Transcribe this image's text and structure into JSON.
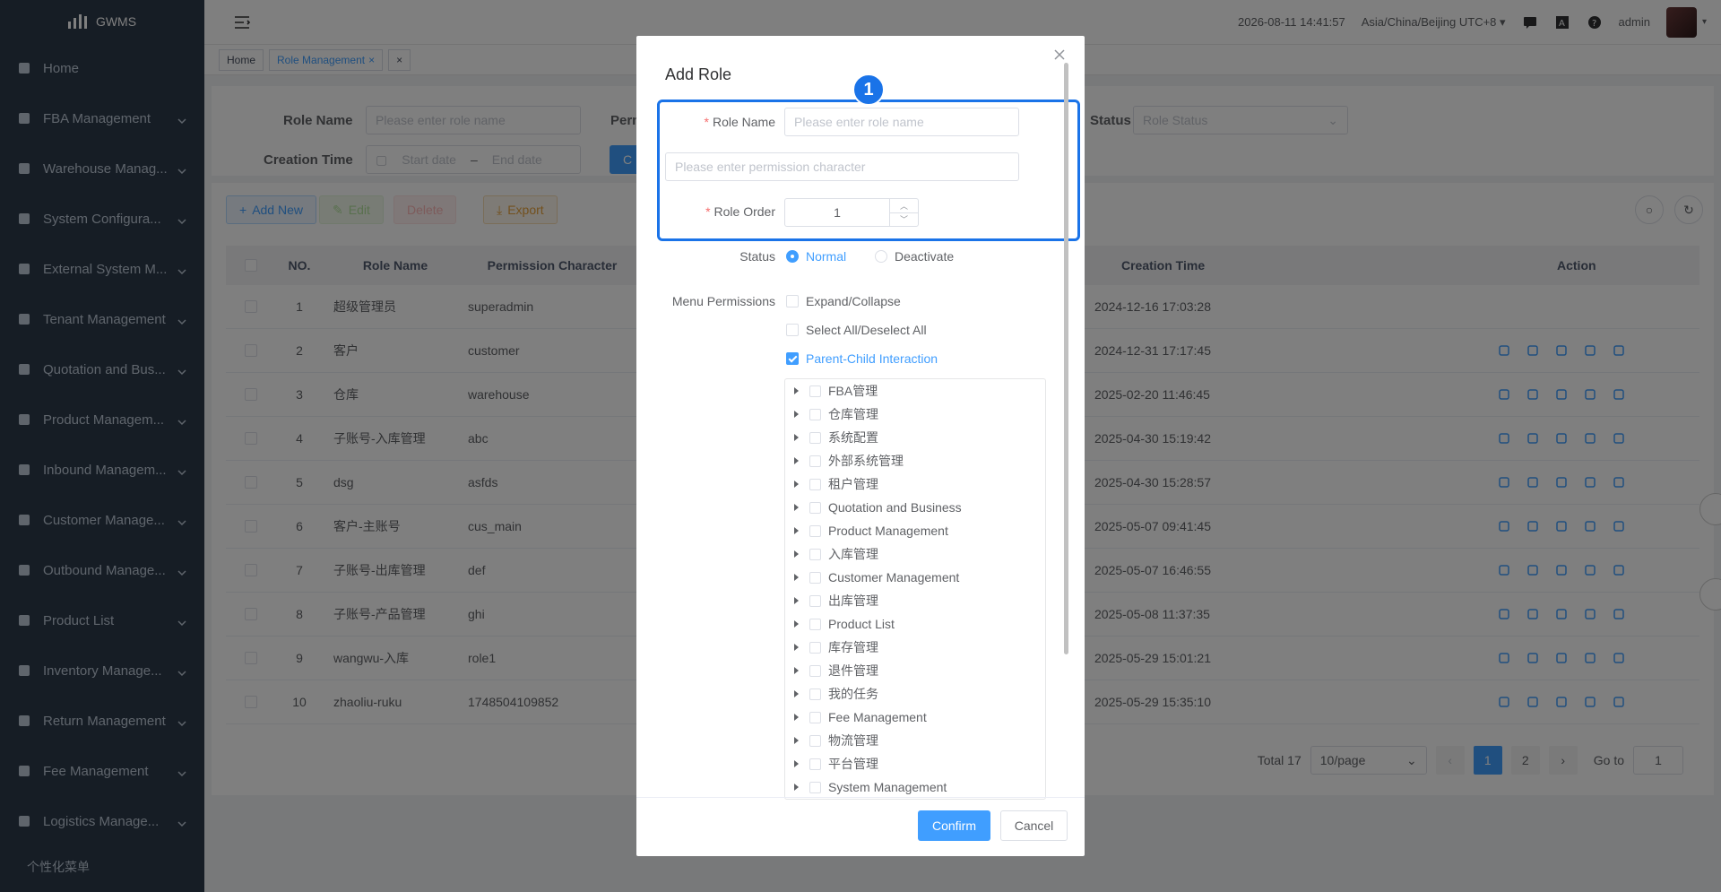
{
  "app": {
    "name": "GWMS"
  },
  "sidebar": {
    "items": [
      {
        "label": "Home",
        "icon": "dashboard-icon",
        "has_children": false
      },
      {
        "label": "FBA Management",
        "icon": "clipboard-icon",
        "has_children": true
      },
      {
        "label": "Warehouse Manag...",
        "icon": "pie-icon",
        "has_children": true
      },
      {
        "label": "System Configura...",
        "icon": "monitor-icon",
        "has_children": true
      },
      {
        "label": "External System M...",
        "icon": "grid-icon",
        "has_children": true
      },
      {
        "label": "Tenant Management",
        "icon": "chart-icon",
        "has_children": true
      },
      {
        "label": "Quotation and Bus...",
        "icon": "doc-icon",
        "has_children": true
      },
      {
        "label": "Product Managem...",
        "icon": "cart-icon",
        "has_children": true
      },
      {
        "label": "Inbound Managem...",
        "icon": "home-icon",
        "has_children": true
      },
      {
        "label": "Customer Manage...",
        "icon": "user-icon",
        "has_children": true
      },
      {
        "label": "Outbound Manage...",
        "icon": "grid-icon",
        "has_children": true
      },
      {
        "label": "Product List",
        "icon": "book-icon",
        "has_children": true
      },
      {
        "label": "Inventory Manage...",
        "icon": "table-icon",
        "has_children": true
      },
      {
        "label": "Return Management",
        "icon": "return-icon",
        "has_children": true
      },
      {
        "label": "Fee Management",
        "icon": "yen-icon",
        "has_children": true
      },
      {
        "label": "Logistics Manage...",
        "icon": "grid-icon",
        "has_children": true
      }
    ],
    "bottom_label": "个性化菜单"
  },
  "topbar": {
    "datetime": "2026-08-11 14:41:57",
    "timezone": "Asia/China/Beijing UTC+8",
    "user": "admin"
  },
  "tags": [
    {
      "label": "Home",
      "active": false
    },
    {
      "label": "Role Management",
      "active": true
    }
  ],
  "search": {
    "role_name_label": "Role Name",
    "role_name_placeholder": "Please enter role name",
    "perm_label_partial": "Perm",
    "status_label": "Status",
    "status_placeholder": "Role Status",
    "creation_time_label": "Creation Time",
    "start_placeholder": "Start date",
    "date_separator": "–",
    "end_placeholder": "End date",
    "search_btn_partial": "C"
  },
  "toolbar": {
    "add_label": "Add New",
    "edit_label": "Edit",
    "delete_label": "Delete",
    "export_label": "Export"
  },
  "table": {
    "headers": {
      "no": "NO.",
      "name": "Role Name",
      "perm": "Permission Character",
      "time": "Creation Time",
      "action": "Action"
    },
    "rows": [
      {
        "no": "1",
        "name": "超级管理员",
        "perm": "superadmin",
        "time": "2024-12-16 17:03:28",
        "actions": false
      },
      {
        "no": "2",
        "name": "客户",
        "perm": "customer",
        "time": "2024-12-31 17:17:45",
        "actions": true
      },
      {
        "no": "3",
        "name": "仓库",
        "perm": "warehouse",
        "time": "2025-02-20 11:46:45",
        "actions": true
      },
      {
        "no": "4",
        "name": "子账号-入库管理",
        "perm": "abc",
        "time": "2025-04-30 15:19:42",
        "actions": true
      },
      {
        "no": "5",
        "name": "dsg",
        "perm": "asfds",
        "time": "2025-04-30 15:28:57",
        "actions": true
      },
      {
        "no": "6",
        "name": "客户-主账号",
        "perm": "cus_main",
        "time": "2025-05-07 09:41:45",
        "actions": true
      },
      {
        "no": "7",
        "name": "子账号-出库管理",
        "perm": "def",
        "time": "2025-05-07 16:46:55",
        "actions": true
      },
      {
        "no": "8",
        "name": "子账号-产品管理",
        "perm": "ghi",
        "time": "2025-05-08 11:37:35",
        "actions": true
      },
      {
        "no": "9",
        "name": "wangwu-入库",
        "perm": "role1",
        "time": "2025-05-29 15:01:21",
        "actions": true
      },
      {
        "no": "10",
        "name": "zhaoliu-ruku",
        "perm": "1748504109852",
        "time": "2025-05-29 15:35:10",
        "actions": true
      }
    ]
  },
  "pagination": {
    "total": "Total 17",
    "page_size": "10/page",
    "pages": [
      "1",
      "2"
    ],
    "current": "1",
    "goto_label": "Go to",
    "goto_value": "1"
  },
  "dialog": {
    "title": "Add Role",
    "annotation_badge": "1",
    "role_name_label": "Role Name",
    "role_name_placeholder": "Please enter role name",
    "perm_placeholder": "Please enter permission character",
    "role_order_label": "Role Order",
    "role_order_value": "1",
    "status_label": "Status",
    "status_normal": "Normal",
    "status_deactivate": "Deactivate",
    "menu_perm_label": "Menu Permissions",
    "expand_collapse": "Expand/Collapse",
    "select_all": "Select All/Deselect All",
    "parent_child": "Parent-Child Interaction",
    "tree": [
      "FBA管理",
      "仓库管理",
      "系统配置",
      "外部系统管理",
      "租户管理",
      "Quotation and Business",
      "Product Management",
      "入库管理",
      "Customer Management",
      "出库管理",
      "Product List",
      "库存管理",
      "退件管理",
      "我的任务",
      "Fee Management",
      "物流管理",
      "平台管理",
      "System Management"
    ],
    "confirm_label": "Confirm",
    "cancel_label": "Cancel"
  },
  "colors": {
    "sidebar_bg": "#2d3a4b",
    "primary": "#409eff",
    "highlight": "#1a73e8"
  }
}
